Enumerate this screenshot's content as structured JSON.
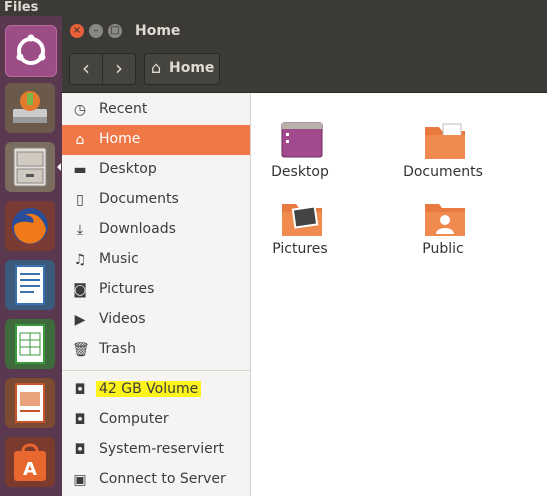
{
  "topbar": {
    "title": "Files"
  },
  "launcher": {
    "items": [
      {
        "name": "ubuntu-dash"
      },
      {
        "name": "disk-utility"
      },
      {
        "name": "files"
      },
      {
        "name": "firefox"
      },
      {
        "name": "libreoffice-writer"
      },
      {
        "name": "libreoffice-calc"
      },
      {
        "name": "libreoffice-impress"
      },
      {
        "name": "software-center"
      }
    ]
  },
  "window": {
    "title": "Home",
    "buttons": {
      "close": "×",
      "minimize": "–",
      "maximize": "□"
    },
    "toolbar": {
      "back": "‹",
      "forward": "›",
      "location_icon": "⌂",
      "location_label": "Home"
    }
  },
  "sidebar": {
    "items": [
      {
        "label": "Recent",
        "icon": "clock-icon"
      },
      {
        "label": "Home",
        "icon": "home-icon"
      },
      {
        "label": "Desktop",
        "icon": "desktop-icon"
      },
      {
        "label": "Documents",
        "icon": "document-icon"
      },
      {
        "label": "Downloads",
        "icon": "download-icon"
      },
      {
        "label": "Music",
        "icon": "music-icon"
      },
      {
        "label": "Pictures",
        "icon": "camera-icon"
      },
      {
        "label": "Videos",
        "icon": "video-icon"
      },
      {
        "label": "Trash",
        "icon": "trash-icon"
      }
    ],
    "devices": [
      {
        "label": "42 GB Volume",
        "icon": "drive-icon"
      },
      {
        "label": "Computer",
        "icon": "drive-icon"
      },
      {
        "label": "System-reserviert",
        "icon": "drive-icon"
      },
      {
        "label": "Connect to Server",
        "icon": "server-icon"
      }
    ]
  },
  "content": {
    "folders": [
      {
        "label": "Desktop",
        "icon": "desktop-folder-icon"
      },
      {
        "label": "Documents",
        "icon": "documents-folder-icon"
      },
      {
        "label": "Pictures",
        "icon": "pictures-folder-icon"
      },
      {
        "label": "Public",
        "icon": "public-folder-icon"
      }
    ]
  },
  "colors": {
    "accent": "#f07746",
    "highlight": "#fcf21c",
    "launcher": "#5a3850"
  }
}
